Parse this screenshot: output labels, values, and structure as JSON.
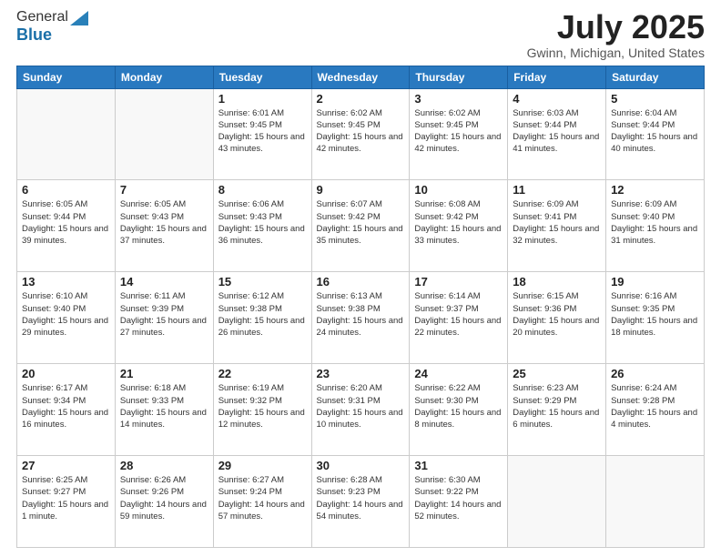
{
  "logo": {
    "line1": "General",
    "line2": "Blue"
  },
  "title": "July 2025",
  "location": "Gwinn, Michigan, United States",
  "days_of_week": [
    "Sunday",
    "Monday",
    "Tuesday",
    "Wednesday",
    "Thursday",
    "Friday",
    "Saturday"
  ],
  "weeks": [
    [
      {
        "day": "",
        "info": ""
      },
      {
        "day": "",
        "info": ""
      },
      {
        "day": "1",
        "info": "Sunrise: 6:01 AM\nSunset: 9:45 PM\nDaylight: 15 hours and 43 minutes."
      },
      {
        "day": "2",
        "info": "Sunrise: 6:02 AM\nSunset: 9:45 PM\nDaylight: 15 hours and 42 minutes."
      },
      {
        "day": "3",
        "info": "Sunrise: 6:02 AM\nSunset: 9:45 PM\nDaylight: 15 hours and 42 minutes."
      },
      {
        "day": "4",
        "info": "Sunrise: 6:03 AM\nSunset: 9:44 PM\nDaylight: 15 hours and 41 minutes."
      },
      {
        "day": "5",
        "info": "Sunrise: 6:04 AM\nSunset: 9:44 PM\nDaylight: 15 hours and 40 minutes."
      }
    ],
    [
      {
        "day": "6",
        "info": "Sunrise: 6:05 AM\nSunset: 9:44 PM\nDaylight: 15 hours and 39 minutes."
      },
      {
        "day": "7",
        "info": "Sunrise: 6:05 AM\nSunset: 9:43 PM\nDaylight: 15 hours and 37 minutes."
      },
      {
        "day": "8",
        "info": "Sunrise: 6:06 AM\nSunset: 9:43 PM\nDaylight: 15 hours and 36 minutes."
      },
      {
        "day": "9",
        "info": "Sunrise: 6:07 AM\nSunset: 9:42 PM\nDaylight: 15 hours and 35 minutes."
      },
      {
        "day": "10",
        "info": "Sunrise: 6:08 AM\nSunset: 9:42 PM\nDaylight: 15 hours and 33 minutes."
      },
      {
        "day": "11",
        "info": "Sunrise: 6:09 AM\nSunset: 9:41 PM\nDaylight: 15 hours and 32 minutes."
      },
      {
        "day": "12",
        "info": "Sunrise: 6:09 AM\nSunset: 9:40 PM\nDaylight: 15 hours and 31 minutes."
      }
    ],
    [
      {
        "day": "13",
        "info": "Sunrise: 6:10 AM\nSunset: 9:40 PM\nDaylight: 15 hours and 29 minutes."
      },
      {
        "day": "14",
        "info": "Sunrise: 6:11 AM\nSunset: 9:39 PM\nDaylight: 15 hours and 27 minutes."
      },
      {
        "day": "15",
        "info": "Sunrise: 6:12 AM\nSunset: 9:38 PM\nDaylight: 15 hours and 26 minutes."
      },
      {
        "day": "16",
        "info": "Sunrise: 6:13 AM\nSunset: 9:38 PM\nDaylight: 15 hours and 24 minutes."
      },
      {
        "day": "17",
        "info": "Sunrise: 6:14 AM\nSunset: 9:37 PM\nDaylight: 15 hours and 22 minutes."
      },
      {
        "day": "18",
        "info": "Sunrise: 6:15 AM\nSunset: 9:36 PM\nDaylight: 15 hours and 20 minutes."
      },
      {
        "day": "19",
        "info": "Sunrise: 6:16 AM\nSunset: 9:35 PM\nDaylight: 15 hours and 18 minutes."
      }
    ],
    [
      {
        "day": "20",
        "info": "Sunrise: 6:17 AM\nSunset: 9:34 PM\nDaylight: 15 hours and 16 minutes."
      },
      {
        "day": "21",
        "info": "Sunrise: 6:18 AM\nSunset: 9:33 PM\nDaylight: 15 hours and 14 minutes."
      },
      {
        "day": "22",
        "info": "Sunrise: 6:19 AM\nSunset: 9:32 PM\nDaylight: 15 hours and 12 minutes."
      },
      {
        "day": "23",
        "info": "Sunrise: 6:20 AM\nSunset: 9:31 PM\nDaylight: 15 hours and 10 minutes."
      },
      {
        "day": "24",
        "info": "Sunrise: 6:22 AM\nSunset: 9:30 PM\nDaylight: 15 hours and 8 minutes."
      },
      {
        "day": "25",
        "info": "Sunrise: 6:23 AM\nSunset: 9:29 PM\nDaylight: 15 hours and 6 minutes."
      },
      {
        "day": "26",
        "info": "Sunrise: 6:24 AM\nSunset: 9:28 PM\nDaylight: 15 hours and 4 minutes."
      }
    ],
    [
      {
        "day": "27",
        "info": "Sunrise: 6:25 AM\nSunset: 9:27 PM\nDaylight: 15 hours and 1 minute."
      },
      {
        "day": "28",
        "info": "Sunrise: 6:26 AM\nSunset: 9:26 PM\nDaylight: 14 hours and 59 minutes."
      },
      {
        "day": "29",
        "info": "Sunrise: 6:27 AM\nSunset: 9:24 PM\nDaylight: 14 hours and 57 minutes."
      },
      {
        "day": "30",
        "info": "Sunrise: 6:28 AM\nSunset: 9:23 PM\nDaylight: 14 hours and 54 minutes."
      },
      {
        "day": "31",
        "info": "Sunrise: 6:30 AM\nSunset: 9:22 PM\nDaylight: 14 hours and 52 minutes."
      },
      {
        "day": "",
        "info": ""
      },
      {
        "day": "",
        "info": ""
      }
    ]
  ]
}
